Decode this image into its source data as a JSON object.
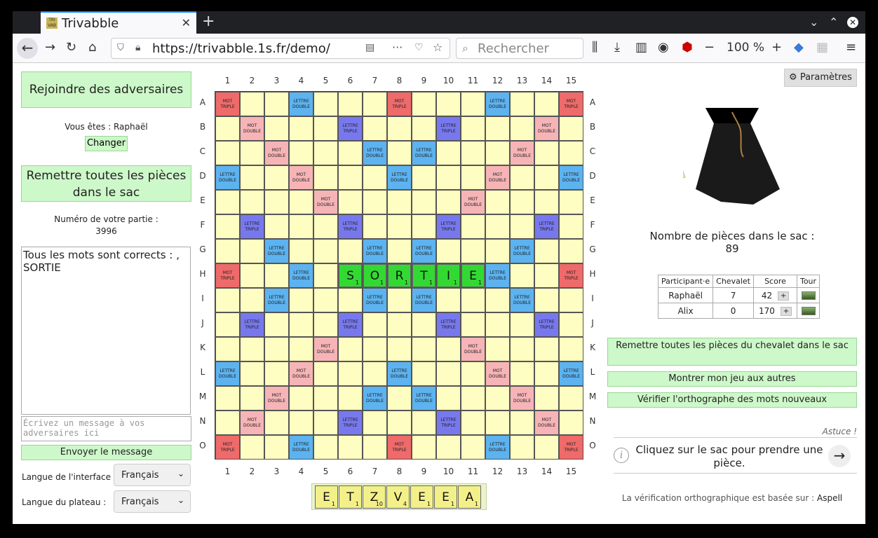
{
  "browser": {
    "tab_title": "Trivabble",
    "url": "https://trivabble.1s.fr/demo/",
    "search_placeholder": "Rechercher",
    "zoom": "100 %"
  },
  "left": {
    "join_label": "Rejoindre des adversaires",
    "you_are": "Vous êtes : Raphaël",
    "change_label": "Changer",
    "recall_all_label": "Remettre toutes les pièces dans le sac",
    "game_number_label": "Numéro de votre partie :",
    "game_number": "3996",
    "chat_log": "Tous les mots sont corrects : , SORTIE",
    "chat_placeholder": "Écrivez un message à vos adversaires ici",
    "send_label": "Envoyer le message",
    "interface_lang_label": "Langue de l'interface :",
    "interface_lang": "Français",
    "board_lang_label": "Langue du plateau :",
    "board_lang": "Français"
  },
  "board": {
    "columns": [
      "1",
      "2",
      "3",
      "4",
      "5",
      "6",
      "7",
      "8",
      "9",
      "10",
      "11",
      "12",
      "13",
      "14",
      "15"
    ],
    "rows": [
      "A",
      "B",
      "C",
      "D",
      "E",
      "F",
      "G",
      "H",
      "I",
      "J",
      "K",
      "L",
      "M",
      "N",
      "O"
    ],
    "premium_labels": {
      "tw": "MOT TRIPLE",
      "dw": "MOT DOUBLE",
      "tl": "LETTRE TRIPLE",
      "dl": "LETTRE DOUBLE"
    },
    "layout": [
      "T..d...T...d..T",
      ".D...t...t...D.",
      "..D...d.d...D..",
      "d..D...d...D..d",
      "....D.....D....",
      ".t...t...t...t.",
      "..d...d.d...d..",
      "T..d.......d..T",
      "..d...d.d...d..",
      ".t...t...t...t.",
      "....D.....D....",
      "d..D...d...D..d",
      "..D...d.d...D..",
      ".D...t...t...D.",
      "T..d...T...d..T"
    ],
    "placed_tiles": [
      {
        "row": 7,
        "col": 5,
        "letter": "S",
        "points": "1"
      },
      {
        "row": 7,
        "col": 6,
        "letter": "O",
        "points": "1"
      },
      {
        "row": 7,
        "col": 7,
        "letter": "R",
        "points": "1"
      },
      {
        "row": 7,
        "col": 8,
        "letter": "T",
        "points": "1"
      },
      {
        "row": 7,
        "col": 9,
        "letter": "I",
        "points": "1"
      },
      {
        "row": 7,
        "col": 10,
        "letter": "E",
        "points": "1"
      }
    ]
  },
  "rack": [
    {
      "letter": "E",
      "points": "1"
    },
    {
      "letter": "T",
      "points": "1"
    },
    {
      "letter": "Z",
      "points": "10"
    },
    {
      "letter": "V",
      "points": "4"
    },
    {
      "letter": "E",
      "points": "1"
    },
    {
      "letter": "E",
      "points": "1"
    },
    {
      "letter": "A",
      "points": "1"
    }
  ],
  "right": {
    "settings_label": "Paramètres",
    "bag_label": "Nombre de pièces dans le sac :",
    "bag_count": "89",
    "table_headers": [
      "Participant·e",
      "Chevalet",
      "Score",
      "Tour"
    ],
    "players": [
      {
        "name": "Raphaël",
        "rack": "7",
        "score": "42"
      },
      {
        "name": "Alix",
        "rack": "0",
        "score": "170"
      }
    ],
    "recall_rack_label": "Remettre toutes les pièces du chevalet dans le sac",
    "show_game_label": "Montrer mon jeu aux autres",
    "check_words_label": "Vérifier l'orthographe des mots nouveaux",
    "tip_label": "Astuce !",
    "tip_text": "Cliquez sur le sac pour prendre une pièce.",
    "spell_note": "La vérification orthographique est basée sur :",
    "spell_engine": "Aspell"
  },
  "icons": {
    "settings": "gear-icon",
    "tip": "info-icon",
    "next": "arrow-right-icon",
    "bag": "bag-icon"
  }
}
